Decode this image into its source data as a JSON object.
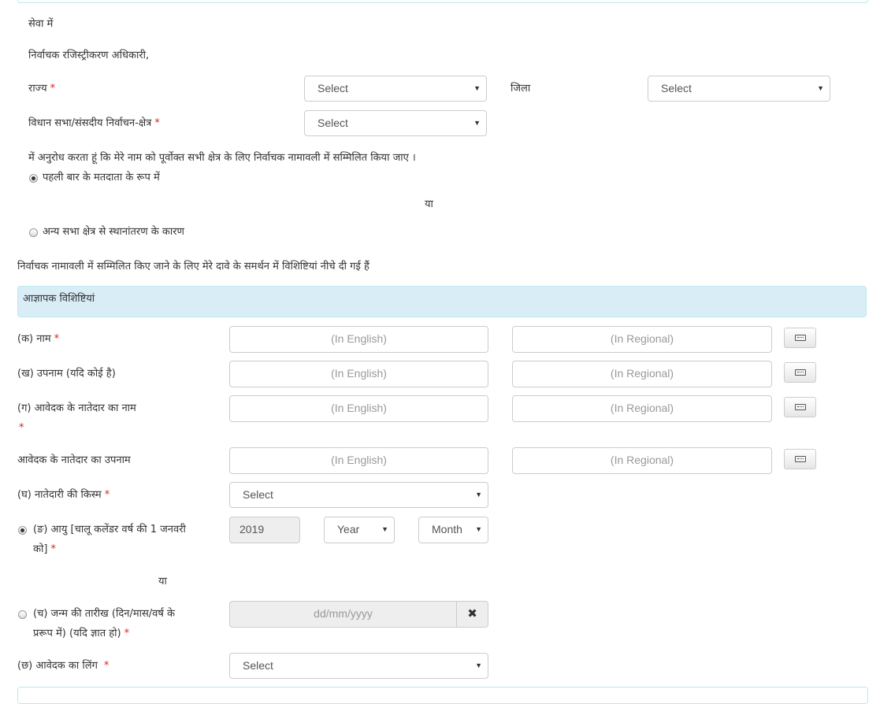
{
  "intro": {
    "salutation": "सेवा में",
    "officer": "निर्वाचक रजिस्ट्रीकरण अधिकारी,"
  },
  "location": {
    "state_label": "राज्य",
    "state_value": "Select",
    "district_label": "जिला",
    "district_value": "Select",
    "constituency_label": "विधान सभा/संसदीय निर्वाचन-क्षेत्र",
    "constituency_value": "Select"
  },
  "request": {
    "text": "में अनुरोध करता हूं कि मेरे नाम को पूर्वोक्त सभी क्षेत्र के लिए निर्वाचक नामावली में सम्मिलित किया जाए ।",
    "option_first_time": "पहली बार के मतदाता के रूप में",
    "or": "या",
    "option_transfer": "अन्य सभा क्षेत्र से स्थानांतरण के कारण"
  },
  "claim_text": "निर्वाचक नामावली में सम्मिलित किए जाने के लिए मेरे दावे के समर्थन में विशिष्टियां नीचे दी गई हैं",
  "panel_title": "आज्ञापक विशिष्टियां",
  "placeholders": {
    "english": "(In English)",
    "regional": "(In Regional)"
  },
  "fields": {
    "name_label": "(क) नाम",
    "surname_label": "(ख) उपनाम (यदि कोई है)",
    "relative_name_label": "(ग) आवेदक के नातेदार का नाम",
    "relative_surname_label": "आवेदक के नातेदार का उपनाम",
    "relation_type_label": "(घ) नातेदारी की किस्म",
    "relation_type_value": "Select",
    "age_label_line1": "(ङ) आयु [चालू कलेंडर वर्ष की 1 जनवरी",
    "age_label_line2": "को]",
    "age_year_value": "2019",
    "age_years_select": "Year",
    "age_month_select": "Month",
    "or": "या",
    "dob_label_line1": "(च) जन्म की तारीख (दिन/मास/वर्ष के",
    "dob_label_line2": "प्ररूप में) (यदि ज्ञात हो)",
    "dob_placeholder": "dd/mm/yyyy",
    "gender_label": "(छ) आवेदक का लिंग",
    "gender_value": "Select"
  },
  "required_mark": "*",
  "icons": {
    "dropdown": "chevron-down-icon",
    "keyboard": "keyboard-icon",
    "clear": "close-icon"
  },
  "colors": {
    "panel_bg": "#d9edf7",
    "panel_border": "#bce8f1",
    "required": "#d9261c"
  }
}
